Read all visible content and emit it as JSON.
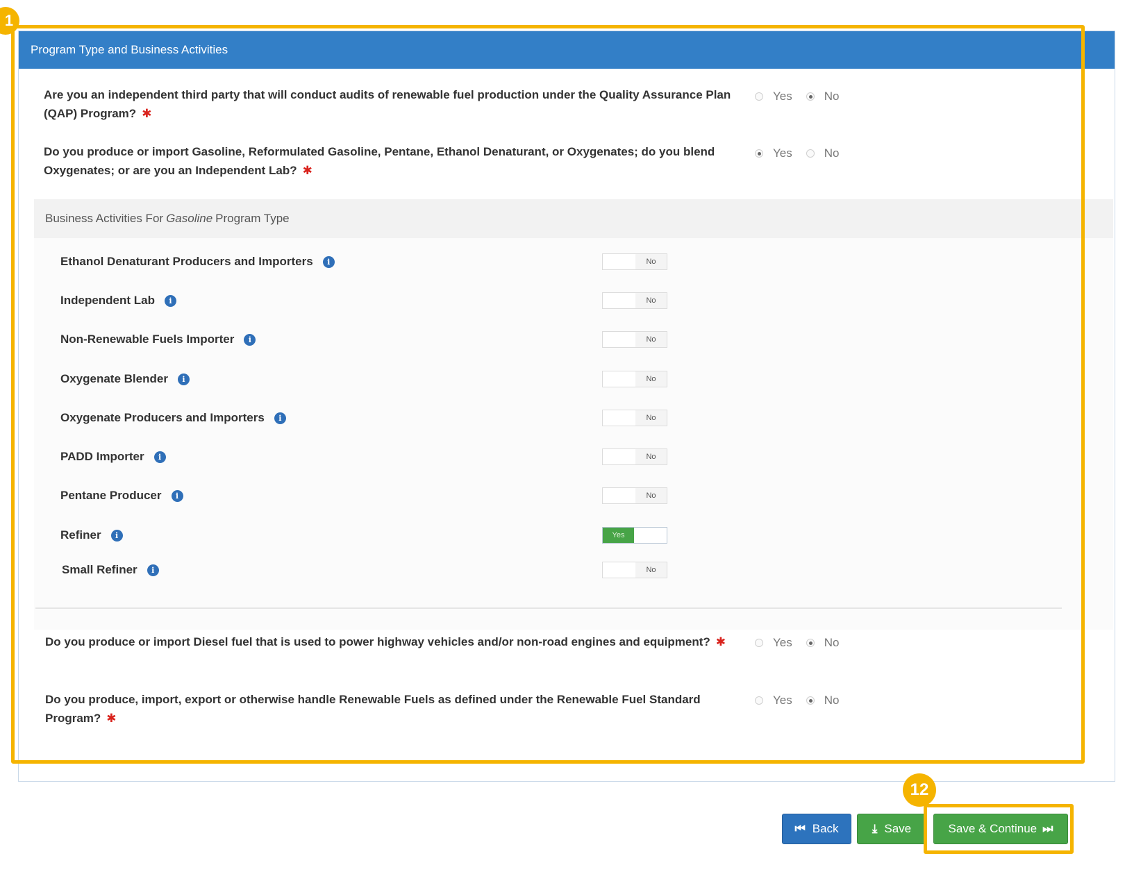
{
  "panel": {
    "title": "Program Type and Business Activities"
  },
  "questions": [
    {
      "text": "Are you an independent third party that will conduct audits of renewable fuel production under the Quality Assurance Plan (QAP) Program?",
      "yes_label": "Yes",
      "no_label": "No",
      "selected": "No"
    },
    {
      "text": "Do you produce or import Gasoline, Reformulated Gasoline, Pentane, Ethanol Denaturant, or Oxygenates; do you blend Oxygenates; or are you an Independent Lab?",
      "yes_label": "Yes",
      "no_label": "No",
      "selected": "Yes"
    },
    {
      "text": "Do you produce or import Diesel fuel that is used to power highway vehicles and/or non-road engines and equipment?",
      "yes_label": "Yes",
      "no_label": "No",
      "selected": "No"
    },
    {
      "text": "Do you produce, import, export or otherwise handle Renewable Fuels as defined under the Renewable Fuel Standard Program?",
      "yes_label": "Yes",
      "no_label": "No",
      "selected": "No"
    }
  ],
  "required_marker": "✱",
  "business_activities": {
    "heading_prefix": "Business Activities For",
    "heading_program": "Gasoline",
    "heading_suffix": "Program Type",
    "info_glyph": "i",
    "items": [
      {
        "label": "Ethanol Denaturant Producers and Importers",
        "state": "No"
      },
      {
        "label": "Independent Lab",
        "state": "No"
      },
      {
        "label": "Non-Renewable Fuels Importer",
        "state": "No"
      },
      {
        "label": "Oxygenate Blender",
        "state": "No"
      },
      {
        "label": "Oxygenate Producers and Importers",
        "state": "No"
      },
      {
        "label": "PADD Importer",
        "state": "No"
      },
      {
        "label": "Pentane Producer",
        "state": "No"
      },
      {
        "label": "Refiner",
        "state": "Yes"
      },
      {
        "label": "Small Refiner",
        "state": "No"
      }
    ]
  },
  "buttons": {
    "back": {
      "label": "Back",
      "icon": "⏮"
    },
    "save": {
      "label": "Save",
      "icon": "⤓"
    },
    "save_continue": {
      "label": "Save & Continue",
      "icon": "⏭"
    }
  },
  "callouts": {
    "first": "1",
    "second": "12"
  },
  "colors": {
    "callout": "#f5b400",
    "panel_header": "#337fc7",
    "success": "#47a447",
    "primary": "#2d73bd",
    "required": "#d9231d"
  }
}
